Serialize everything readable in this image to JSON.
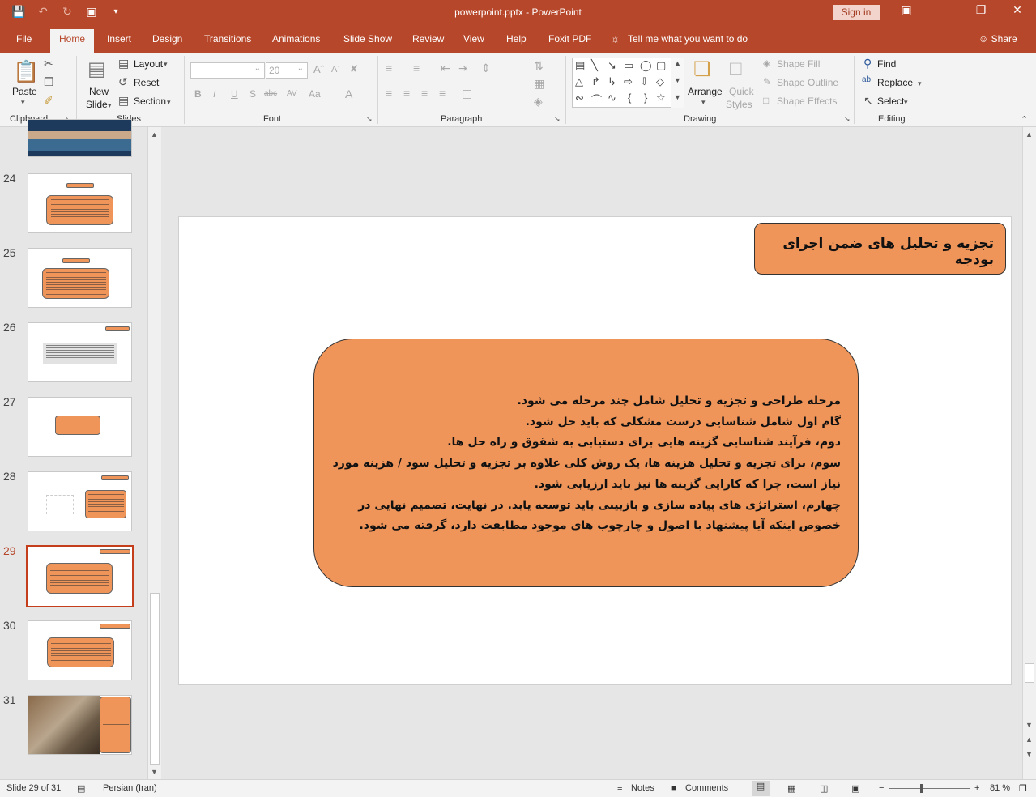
{
  "titlebar": {
    "document_title": "powerpoint.pptx  -  PowerPoint",
    "signin_label": "Sign in",
    "qat_icons": [
      "save-icon",
      "undo-icon",
      "redo-icon",
      "start-from-beginning-icon",
      "customize-qat-icon"
    ],
    "window_controls": [
      "ribbon-display-icon",
      "minimize-icon",
      "restore-icon",
      "close-icon"
    ]
  },
  "tabs": [
    "File",
    "Home",
    "Insert",
    "Design",
    "Transitions",
    "Animations",
    "Slide Show",
    "Review",
    "View",
    "Help",
    "Foxit PDF"
  ],
  "active_tab": "Home",
  "tellme": {
    "icon": "lightbulb-icon",
    "label": "Tell me what you want to do"
  },
  "share_label": "Share",
  "ribbon": {
    "clipboard": {
      "label": "Clipboard",
      "paste": "Paste"
    },
    "slides": {
      "label": "Slides",
      "new_slide_line1": "New",
      "new_slide_line2": "Slide",
      "layout": "Layout",
      "reset": "Reset",
      "section": "Section"
    },
    "font": {
      "label": "Font",
      "font_name": "",
      "font_size": "20",
      "bold": "B",
      "italic": "I",
      "underline": "U",
      "shadow": "S",
      "strike": "abc",
      "spacing": "AV",
      "case": "Aa",
      "color": "A"
    },
    "paragraph": {
      "label": "Paragraph"
    },
    "drawing": {
      "label": "Drawing",
      "arrange": "Arrange",
      "quick_styles_line1": "Quick",
      "quick_styles_line2": "Styles",
      "shape_fill": "Shape Fill",
      "shape_outline": "Shape Outline",
      "shape_effects": "Shape Effects"
    },
    "editing": {
      "label": "Editing",
      "find": "Find",
      "replace": "Replace",
      "select": "Select"
    }
  },
  "thumbnails": [
    {
      "number": "24",
      "selected": false
    },
    {
      "number": "25",
      "selected": false
    },
    {
      "number": "26",
      "selected": false
    },
    {
      "number": "27",
      "selected": false
    },
    {
      "number": "28",
      "selected": false
    },
    {
      "number": "29",
      "selected": true
    },
    {
      "number": "30",
      "selected": false
    },
    {
      "number": "31",
      "selected": false
    }
  ],
  "slide": {
    "title": "تجزیه و تحلیل های ضمن اجرای بودجه",
    "body_lines": [
      "مرحله طراحی و تجزیه و تحلیل شامل چند مرحله می شود.",
      "گام اول شامل شناسایی درست مشکلی که باید حل شود.",
      "دوم، فرآیند شناسایی گزینه هایی برای دستیابی به شقوق و راه حل ها.",
      "سوم، برای تجزیه و تحلیل هزینه ها، یک روش کلی علاوه بر تجزیه و تحلیل سود / هزینه مورد نیاز است، چرا که کارایی گزینه ها نیز باید ارزیابی شود.",
      "چهارم، استراتژی های پیاده سازی و بازبینی باید توسعه یابد. در نهایت، تصمیم نهایی در خصوص اینکه آیا پیشنهاد با اصول و چارچوب های موجود مطابقت دارد، گرفته می شود."
    ],
    "fill_color": "#f0955a"
  },
  "statusbar": {
    "slide_info": "Slide 29 of 31",
    "language": "Persian (Iran)",
    "notes": "Notes",
    "comments": "Comments",
    "zoom": "81 %",
    "zoom_minus": "−",
    "zoom_plus": "+"
  },
  "colors": {
    "accent": "#b7472a",
    "shape_fill": "#f0955a"
  }
}
